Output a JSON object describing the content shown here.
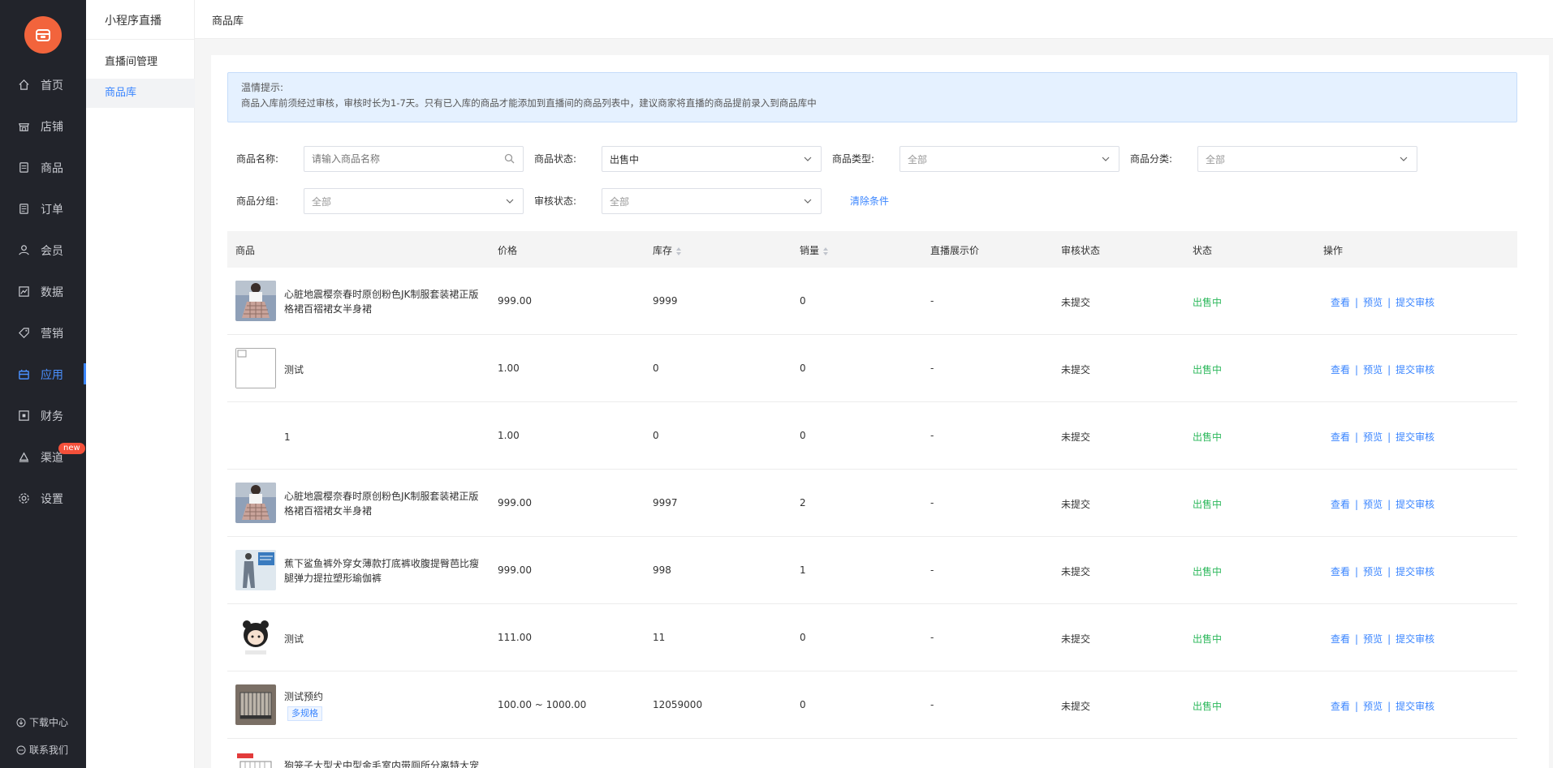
{
  "sidebar": {
    "logo_icon": "store-icon",
    "items": [
      {
        "label": "首页",
        "icon": "home-icon"
      },
      {
        "label": "店铺",
        "icon": "shop-icon"
      },
      {
        "label": "商品",
        "icon": "goods-icon"
      },
      {
        "label": "订单",
        "icon": "order-icon"
      },
      {
        "label": "会员",
        "icon": "member-icon"
      },
      {
        "label": "数据",
        "icon": "chart-icon"
      },
      {
        "label": "营销",
        "icon": "tag-icon"
      },
      {
        "label": "应用",
        "icon": "app-icon",
        "active": true
      },
      {
        "label": "财务",
        "icon": "finance-icon"
      },
      {
        "label": "渠道",
        "icon": "channel-icon",
        "badge": "new"
      },
      {
        "label": "设置",
        "icon": "gear-icon"
      }
    ],
    "footer": {
      "download": "下载中心",
      "contact": "联系我们"
    }
  },
  "submenu": {
    "title": "小程序直播",
    "items": [
      "直播间管理",
      "商品库"
    ],
    "active_index": 1
  },
  "header": {
    "breadcrumb": "商品库"
  },
  "tip": {
    "title": "温情提示:",
    "text": "商品入库前须经过审核，审核时长为1-7天。只有已入库的商品才能添加到直播间的商品列表中，建议商家将直播的商品提前录入到商品库中"
  },
  "filters": {
    "name_label": "商品名称:",
    "name_placeholder": "请输入商品名称",
    "status_label": "商品状态:",
    "status_value": "出售中",
    "type_label": "商品类型:",
    "type_value": "全部",
    "category_label": "商品分类:",
    "category_value": "全部",
    "group_label": "商品分组:",
    "group_value": "全部",
    "audit_label": "审核状态:",
    "audit_value": "全部",
    "clear_label": "清除条件"
  },
  "table": {
    "headers": {
      "product": "商品",
      "price": "价格",
      "stock": "库存",
      "sales": "销量",
      "live_price": "直播展示价",
      "audit": "审核状态",
      "status": "状态",
      "ops": "操作"
    },
    "op_labels": {
      "view": "查看",
      "preview": "预览",
      "submit": "提交审核"
    },
    "rows": [
      {
        "name": "心脏地震樱奈春时原创粉色JK制服套装裙正版格裙百褶裙女半身裙",
        "thumb": "skirt",
        "price": "999.00",
        "stock": "9999",
        "sales": "0",
        "live_price": "-",
        "audit": "未提交",
        "status": "出售中"
      },
      {
        "name": "测试",
        "thumb": "broken",
        "price": "1.00",
        "stock": "0",
        "sales": "0",
        "live_price": "-",
        "audit": "未提交",
        "status": "出售中"
      },
      {
        "name": "1",
        "thumb": "none",
        "price": "1.00",
        "stock": "0",
        "sales": "0",
        "live_price": "-",
        "audit": "未提交",
        "status": "出售中"
      },
      {
        "name": "心脏地震樱奈春时原创粉色JK制服套装裙正版格裙百褶裙女半身裙",
        "thumb": "skirt",
        "price": "999.00",
        "stock": "9997",
        "sales": "2",
        "live_price": "-",
        "audit": "未提交",
        "status": "出售中"
      },
      {
        "name": "蕉下鲨鱼裤外穿女薄款打底裤收腹提臀芭比瘦腿弹力提拉塑形瑜伽裤",
        "thumb": "pants",
        "price": "999.00",
        "stock": "998",
        "sales": "1",
        "live_price": "-",
        "audit": "未提交",
        "status": "出售中"
      },
      {
        "name": "测试",
        "thumb": "cartoon",
        "price": "111.00",
        "stock": "11",
        "sales": "0",
        "live_price": "-",
        "audit": "未提交",
        "status": "出售中"
      },
      {
        "name": "测试预约",
        "tag": "多规格",
        "thumb": "cage",
        "price": "100.00 ~ 1000.00",
        "stock": "12059000",
        "sales": "0",
        "live_price": "-",
        "audit": "未提交",
        "status": "出售中"
      },
      {
        "name": "狗笼子大型犬中型金毛室内带厕所分离特大宠",
        "thumb": "cage2",
        "price": "",
        "stock": "",
        "sales": "",
        "live_price": "",
        "audit": "",
        "status": ""
      }
    ]
  }
}
